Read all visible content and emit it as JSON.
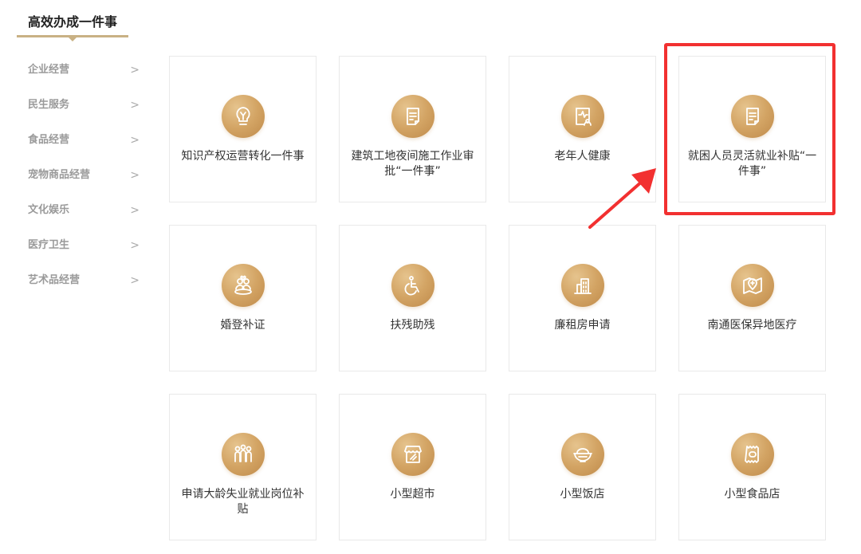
{
  "header": {
    "title": "高效办成一件事"
  },
  "sidebar": {
    "items": [
      {
        "label": "企业经营",
        "chevron": ">"
      },
      {
        "label": "民生服务",
        "chevron": ">"
      },
      {
        "label": "食品经营",
        "chevron": ">"
      },
      {
        "label": "宠物商品经营",
        "chevron": ">"
      },
      {
        "label": "文化娱乐",
        "chevron": ">"
      },
      {
        "label": "医疗卫生",
        "chevron": ">"
      },
      {
        "label": "艺术品经营",
        "chevron": ">"
      }
    ]
  },
  "cards": [
    {
      "label": "知识产权运营转化一件事",
      "icon": "lightbulb-icon"
    },
    {
      "label": "建筑工地夜间施工作业审批“一件事”",
      "icon": "document-icon"
    },
    {
      "label": "老年人健康",
      "icon": "health-report-icon"
    },
    {
      "label": "就困人员灵活就业补贴“一件事”",
      "icon": "document-icon"
    },
    {
      "label": "婚登补证",
      "icon": "marriage-icon"
    },
    {
      "label": "扶残助残",
      "icon": "wheelchair-icon"
    },
    {
      "label": "廉租房申请",
      "icon": "building-icon"
    },
    {
      "label": "南通医保异地医疗",
      "icon": "map-pin-icon"
    },
    {
      "label": "申请大龄失业就业岗位补贴",
      "icon": "people-group-icon"
    },
    {
      "label": "小型超市",
      "icon": "store-icon"
    },
    {
      "label": "小型饭店",
      "icon": "rice-bowl-icon"
    },
    {
      "label": "小型食品店",
      "icon": "food-package-icon"
    }
  ],
  "colors": {
    "accent": "#c9b184",
    "icon_gold": "#d3a464",
    "highlight_red": "#f23030"
  }
}
